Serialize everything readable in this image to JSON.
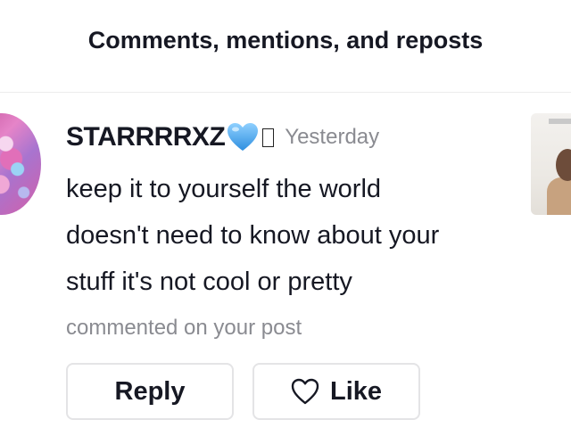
{
  "header": {
    "title": "Comments, mentions, and reposts"
  },
  "notification": {
    "username": "STARRRRXZ",
    "username_emoji": "blue-heart-icon",
    "timestamp": "Yesterday",
    "comment_lines": [
      "keep it to yourself the world",
      "doesn't need to know about your",
      "stuff it's not cool or pretty"
    ],
    "subtext": "commented on your post",
    "actions": {
      "reply_label": "Reply",
      "like_label": "Like",
      "like_icon": "heart-outline-icon"
    }
  },
  "colors": {
    "primary_text": "#161823",
    "secondary_text": "#8a8b91",
    "button_border": "#e4e4e6",
    "divider": "#ececec",
    "heart_blue": "#4aa8f0"
  }
}
